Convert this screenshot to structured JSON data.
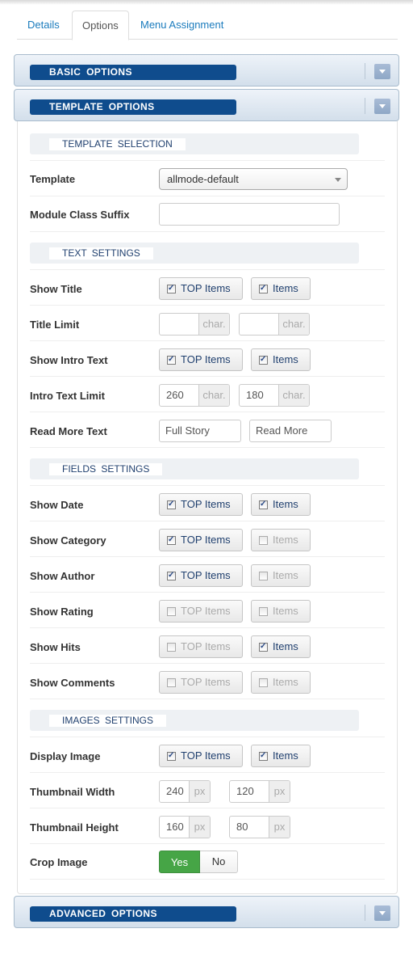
{
  "tabs": [
    {
      "label": "Details",
      "active": false
    },
    {
      "label": "Options",
      "active": true
    },
    {
      "label": "Menu Assignment",
      "active": false
    }
  ],
  "accordions": {
    "basic": "BASIC  OPTIONS",
    "template": "TEMPLATE  OPTIONS",
    "advanced": "ADVANCED  OPTIONS"
  },
  "sections": {
    "template_selection": "TEMPLATE  SELECTION",
    "text_settings": "TEXT  SETTINGS",
    "fields_settings": "FIELDS  SETTINGS",
    "images_settings": "IMAGES  SETTINGS"
  },
  "fields": {
    "template": {
      "label": "Template",
      "value": "allmode-default"
    },
    "module_class_suffix": {
      "label": "Module Class Suffix",
      "value": ""
    },
    "show_title": {
      "label": "Show Title",
      "top_label": "TOP Items",
      "top_checked": true,
      "items_label": "Items",
      "items_checked": true
    },
    "title_limit": {
      "label": "Title Limit",
      "top_value": "",
      "items_value": "",
      "unit": "char."
    },
    "show_intro_text": {
      "label": "Show Intro Text",
      "top_label": "TOP Items",
      "top_checked": true,
      "items_label": "Items",
      "items_checked": true
    },
    "intro_text_limit": {
      "label": "Intro Text Limit",
      "top_value": "260",
      "items_value": "180",
      "unit": "char."
    },
    "read_more_text": {
      "label": "Read More Text",
      "top_value": "Full Story",
      "items_value": "Read More"
    },
    "show_date": {
      "label": "Show Date",
      "top_label": "TOP Items",
      "top_checked": true,
      "items_label": "Items",
      "items_checked": true
    },
    "show_category": {
      "label": "Show Category",
      "top_label": "TOP Items",
      "top_checked": true,
      "items_label": "Items",
      "items_checked": false
    },
    "show_author": {
      "label": "Show Author",
      "top_label": "TOP Items",
      "top_checked": true,
      "items_label": "Items",
      "items_checked": false
    },
    "show_rating": {
      "label": "Show Rating",
      "top_label": "TOP Items",
      "top_checked": false,
      "items_label": "Items",
      "items_checked": false
    },
    "show_hits": {
      "label": "Show Hits",
      "top_label": "TOP Items",
      "top_checked": false,
      "items_label": "Items",
      "items_checked": true
    },
    "show_comments": {
      "label": "Show Comments",
      "top_label": "TOP Items",
      "top_checked": false,
      "items_label": "Items",
      "items_checked": false
    },
    "display_image": {
      "label": "Display Image",
      "top_label": "TOP Items",
      "top_checked": true,
      "items_label": "Items",
      "items_checked": true
    },
    "thumbnail_width": {
      "label": "Thumbnail Width",
      "top_value": "240",
      "items_value": "120",
      "unit": "px"
    },
    "thumbnail_height": {
      "label": "Thumbnail Height",
      "top_value": "160",
      "items_value": "80",
      "unit": "px"
    },
    "crop_image": {
      "label": "Crop Image",
      "yes_label": "Yes",
      "no_label": "No",
      "value": "Yes"
    }
  },
  "check_glyph": "✓",
  "colors": {
    "accent": "#0f4c8d",
    "link": "#1a7bbd",
    "yes_green": "#46a546"
  }
}
